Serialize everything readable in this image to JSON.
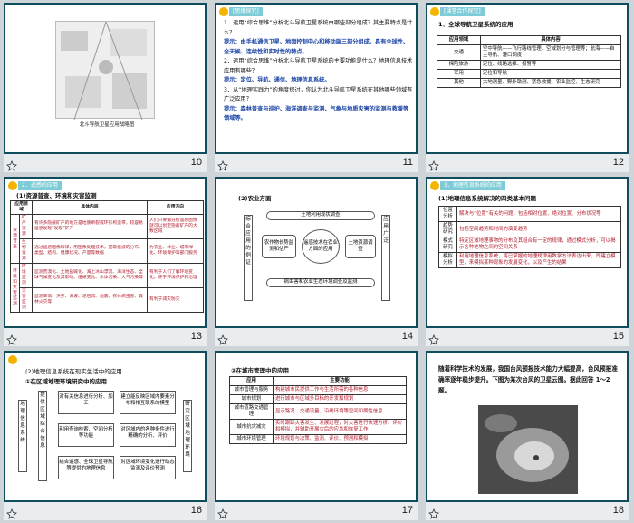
{
  "slides": [
    {
      "page": "10",
      "map_caption": "北斗导航卫星应用战略图"
    },
    {
      "page": "11",
      "banner": "[思维探究]",
      "q1": "1．运用“综合思维”分析北斗导航卫星系统由哪些部分组成？其主要特点是什么？",
      "a1": "提示：由手机通信卫星、地面控制中心和移动端三部分组成。具有全球性、全天候、连续性和实时性的特点。",
      "q2": "2．运用“综合思维”分析北斗导航卫星系统的主要功能是什么？地理信息技术应用有哪些？",
      "a2": "提示：定位、导航、通信、地理信息系统。",
      "q3": "3．从“地理实践力”的角度探讨，你认为北斗导航卫星系统在其他哪些领域有广泛应用？",
      "a3": "提示：森林普查与巡护、海洋调查与监测、气象与地质灾害的监测与救援等领域等。"
    },
    {
      "page": "12",
      "banner": "[课堂合作探究]",
      "head": "1．全球导航卫星系统的应用",
      "table_head": [
        "应用领域",
        "具体内容"
      ],
      "rows": [
        [
          "交通",
          "空中导航——飞行路线管理、空域划分与管理等；航海——自主导航、港口调度"
        ],
        [
          "探险旅游",
          "定位、线路选择、报警等"
        ],
        [
          "军用",
          "定位和导航"
        ],
        [
          "其他",
          "大地测量、野外勘测、紧急救援、农业监控、生态研究"
        ]
      ]
    },
    {
      "page": "13",
      "banner": "2．遥感的应用",
      "head": "(1)资源普查、环境和灾害监测",
      "table_head": [
        "应用领域",
        "具体内容",
        "应用方向"
      ],
      "g1": "资源普查",
      "g2": "环境和灾害监测",
      "r1_sub": "矿产资源",
      "r1_content": "有许多隐蔽矿产的地方是地质断裂或环形构造带，较容易遥感发现“发现”矿产",
      "r1_dir": "人们只要据分析遥感图像就可以划定隐蔽矿产的大致区域",
      "r2_sub": "生物资源",
      "r2_content": "通过遥感图像解译，用图像处理技术，提取植被的分布、类型、结构、健康状况、产量等数据",
      "r2_dir": "为农业、林业、城市绿化、环境保护等部门服务",
      "r3_sub": "环境监测",
      "r3_content": "监测荒漠化、土地盐碱化、海上冰山漂流、海洋生态、全球气候变化及其影响、植被变化、水体污染、大气污染等",
      "r3_dir": "有利于人们了解环境变化，便于环境保护和治理",
      "r4_sub": "灾害监测",
      "r4_content": "监测旱情、洪灾、滑坡、泥石流、地震、农林病虫害、森林火灾等",
      "r4_dir": "有利于减灾防灾"
    },
    {
      "page": "14",
      "head": "(2)农业方面",
      "left_label": "综合应用的例证",
      "right_label": "应用广泛",
      "top_box": "土地利用现状调查",
      "l_box": "农作物长势监测和估产",
      "center": "遥感技术在农业方面的应用",
      "r_box": "土地资源调查",
      "bottom_box": "病虫害和农业生态环境调查及监测"
    },
    {
      "page": "15",
      "banner": "3．地理信息系统的应用",
      "head": "(1)地理信息系统解决的四类基本问题",
      "rows": [
        [
          "位置分析",
          "解决与“位置”有关的问题，包括相对位置、绝对位置、分布状况等"
        ],
        [
          "趋势研究",
          "包括空间趋势和时间的演变趋势"
        ],
        [
          "模式研究",
          "特定区域地理事物的分布及其组合有一定的规律，通过模式分析，可以揭示各种地物之间的空间关系"
        ],
        [
          "模拟分析",
          "利用地理信息系统，将已掌握的地理规律用数学方法表达出来，即建立模型，来模拟某种现象的发展变化，以及产生的结果"
        ]
      ]
    },
    {
      "page": "16",
      "head": "(2)地理信息系统在现实生活中的应用",
      "sub": "①在区域地理环境研究中的应用",
      "left_label": "地理信息系统",
      "mid_label": "提供区域综合信息",
      "right_label": "研究区域地理环境",
      "boxes": [
        "对有关信息进行分析、加工",
        "建立能反映区域内要素分布和相互联系的模型",
        "利用查询检索、空间分析等功能",
        "对区域内的各种条件进行精确的分析、评价",
        "结合遥感、全球卫星导航等提供的地理信息",
        "对区域环境变化进行动态监测及评价预测"
      ]
    },
    {
      "page": "17",
      "head": "②在城市管理中的应用",
      "table_head": [
        "应用",
        "主要功能"
      ],
      "rows": [
        [
          "城市管理与服务",
          "构建城市民提供工作与生活所需的各种信息"
        ],
        [
          "城市规划",
          "进行城市与区域多目标的开发和规划"
        ],
        [
          "城市道路交通管理",
          "显示路况、交通流量、沿线环境等空间和属性信息"
        ],
        [
          "城市抗灾减灾",
          "实时跟踪灾害发生、发展过程，对灾害进行快速分析、评价和模拟，并辅助开展灾后的应急和恢复工作"
        ],
        [
          "城市环境管理",
          "环境规划与决策、监测、评价、预测和模拟"
        ]
      ]
    },
    {
      "page": "18",
      "text": "随着科学技术的发展，我国台风预报技术能力大幅提高，台风预报准确率逐年稳步提升。下图为某次台风的卫星云图。据此回答 1～2 题。"
    }
  ]
}
